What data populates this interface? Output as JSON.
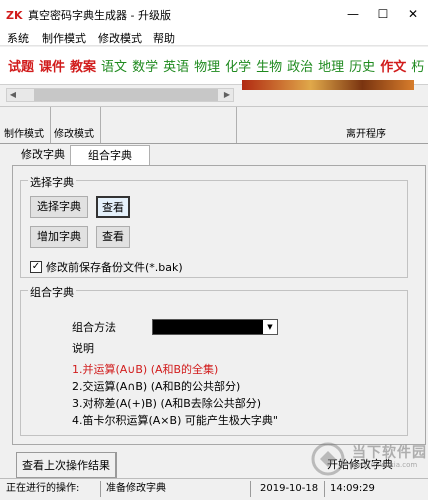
{
  "window": {
    "title": "真空密码字典生成器 - 升级版",
    "minimize_glyph": "—",
    "maximize_glyph": "☐",
    "close_glyph": "✕"
  },
  "menu": [
    "系统",
    "制作模式",
    "修改模式",
    "帮助"
  ],
  "subjects": [
    {
      "label": "试题",
      "color": "#d11c1c"
    },
    {
      "label": "课件",
      "color": "#d11c1c"
    },
    {
      "label": "教案",
      "color": "#d11c1c"
    },
    {
      "label": "语文",
      "color": "#1f8a1f"
    },
    {
      "label": "数学",
      "color": "#1f8a1f"
    },
    {
      "label": "英语",
      "color": "#1f8a1f"
    },
    {
      "label": "物理",
      "color": "#1f8a1f"
    },
    {
      "label": "化学",
      "color": "#1f8a1f"
    },
    {
      "label": "生物",
      "color": "#1f8a1f"
    },
    {
      "label": "政治",
      "color": "#1f8a1f"
    },
    {
      "label": "地理",
      "color": "#1f8a1f"
    },
    {
      "label": "历史",
      "color": "#1f8a1f"
    },
    {
      "label": "作文",
      "color": "#d11c1c"
    },
    {
      "label": "朽",
      "color": "#1f8a1f"
    }
  ],
  "modebar": {
    "make_mode": "制作模式",
    "edit_mode": "修改模式",
    "exit": "离开程序"
  },
  "tabs": [
    "修改字典",
    "组合字典"
  ],
  "select_group": {
    "title": "选择字典",
    "select_btn": "选择字典",
    "view_btn_1": "查看",
    "add_btn": "增加字典",
    "view_btn_2": "查看",
    "checkbox_label": "修改前保存备份文件(*.bak)",
    "checkbox_checked": "✓"
  },
  "combine_group": {
    "title": "组合字典",
    "method_label": "组合方法",
    "dropdown_arrow": "▼",
    "desc_label": "说明",
    "lines": [
      "1.并运算(A∪B) (A和B的全集)",
      "2.交运算(A∩B) (A和B的公共部分)",
      "3.对称差(A(+)B) (A和B去除公共部分)",
      "4.笛卡尔积运算(A×B) 可能产生极大字典\""
    ]
  },
  "bottom": {
    "last_result_btn": "查看上次操作结果",
    "start_btn": "开始修改字典"
  },
  "status": {
    "label": "正在进行的操作:",
    "operation": "准备修改字典",
    "date": "2019-10-18",
    "time": "14:09:29"
  },
  "watermark": {
    "text": "当下软件园",
    "sub": "www.downxia.com"
  }
}
